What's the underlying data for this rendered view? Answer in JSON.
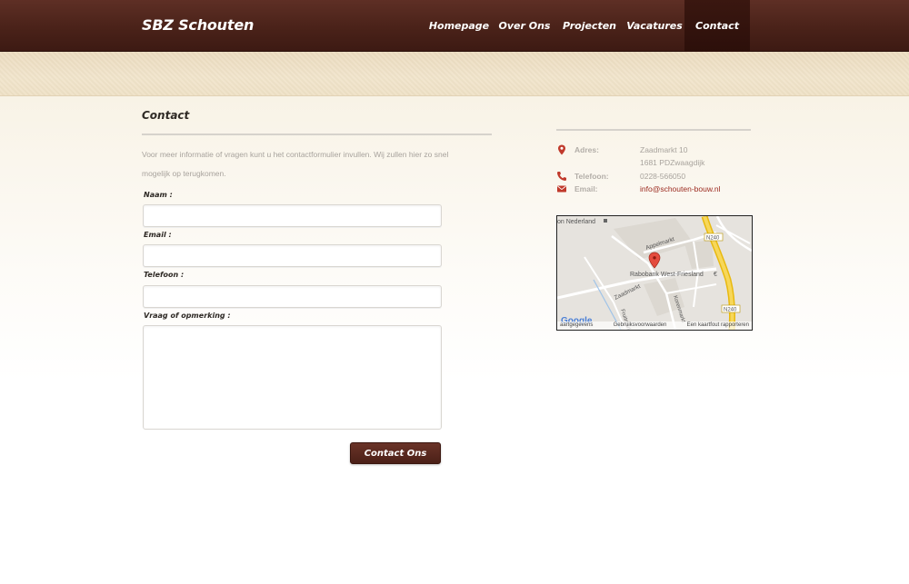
{
  "site": {
    "logo": "SBZ Schouten"
  },
  "nav": {
    "items": [
      {
        "label": "Homepage"
      },
      {
        "label": "Over Ons"
      },
      {
        "label": "Projecten"
      },
      {
        "label": "Vacatures"
      },
      {
        "label": "Contact",
        "active": true
      }
    ]
  },
  "page": {
    "title": "Contact",
    "intro": "Voor meer informatie of vragen kunt u het contactformulier invullen. Wij zullen hier zo snel mogelijk op terugkomen."
  },
  "form": {
    "name_label": "Naam :",
    "name_value": "",
    "email_label": "Email :",
    "email_value": "",
    "phone_label": "Telefoon :",
    "phone_value": "",
    "message_label": "Vraag of opmerking :",
    "message_value": "",
    "submit_label": "Contact Ons"
  },
  "contact_info": {
    "address_label": "Adres:",
    "address_line1": "Zaadmarkt 10",
    "address_line2": "1681 PDZwaagdijk",
    "phone_label": "Telefoon:",
    "phone_value": "0228-566050",
    "email_label": "Email:",
    "email_value": "info@schouten-bouw.nl",
    "icon_color": "#c0392b"
  },
  "map": {
    "top_label": "on Nederland",
    "street_appelmarkt": "Appelmarkt",
    "street_zaadmarkt": "Zaadmarkt",
    "street_koren": "Korenmarkt",
    "street_fruit": "Fruitmarkt",
    "road_shield_1": "N240",
    "road_shield_2": "N240",
    "marker_label": "Rabobank West-Friesland",
    "marker_extra": "€",
    "logo": "Google",
    "footer_left": "aartgegevens",
    "footer_middle": "Gebruiksvoorwaarden",
    "footer_right": "Een kaartfout rapporteren"
  },
  "colors": {
    "header_brown": "#4a2219",
    "link_red": "#9c2b20",
    "button_brown": "#5a2a20"
  }
}
